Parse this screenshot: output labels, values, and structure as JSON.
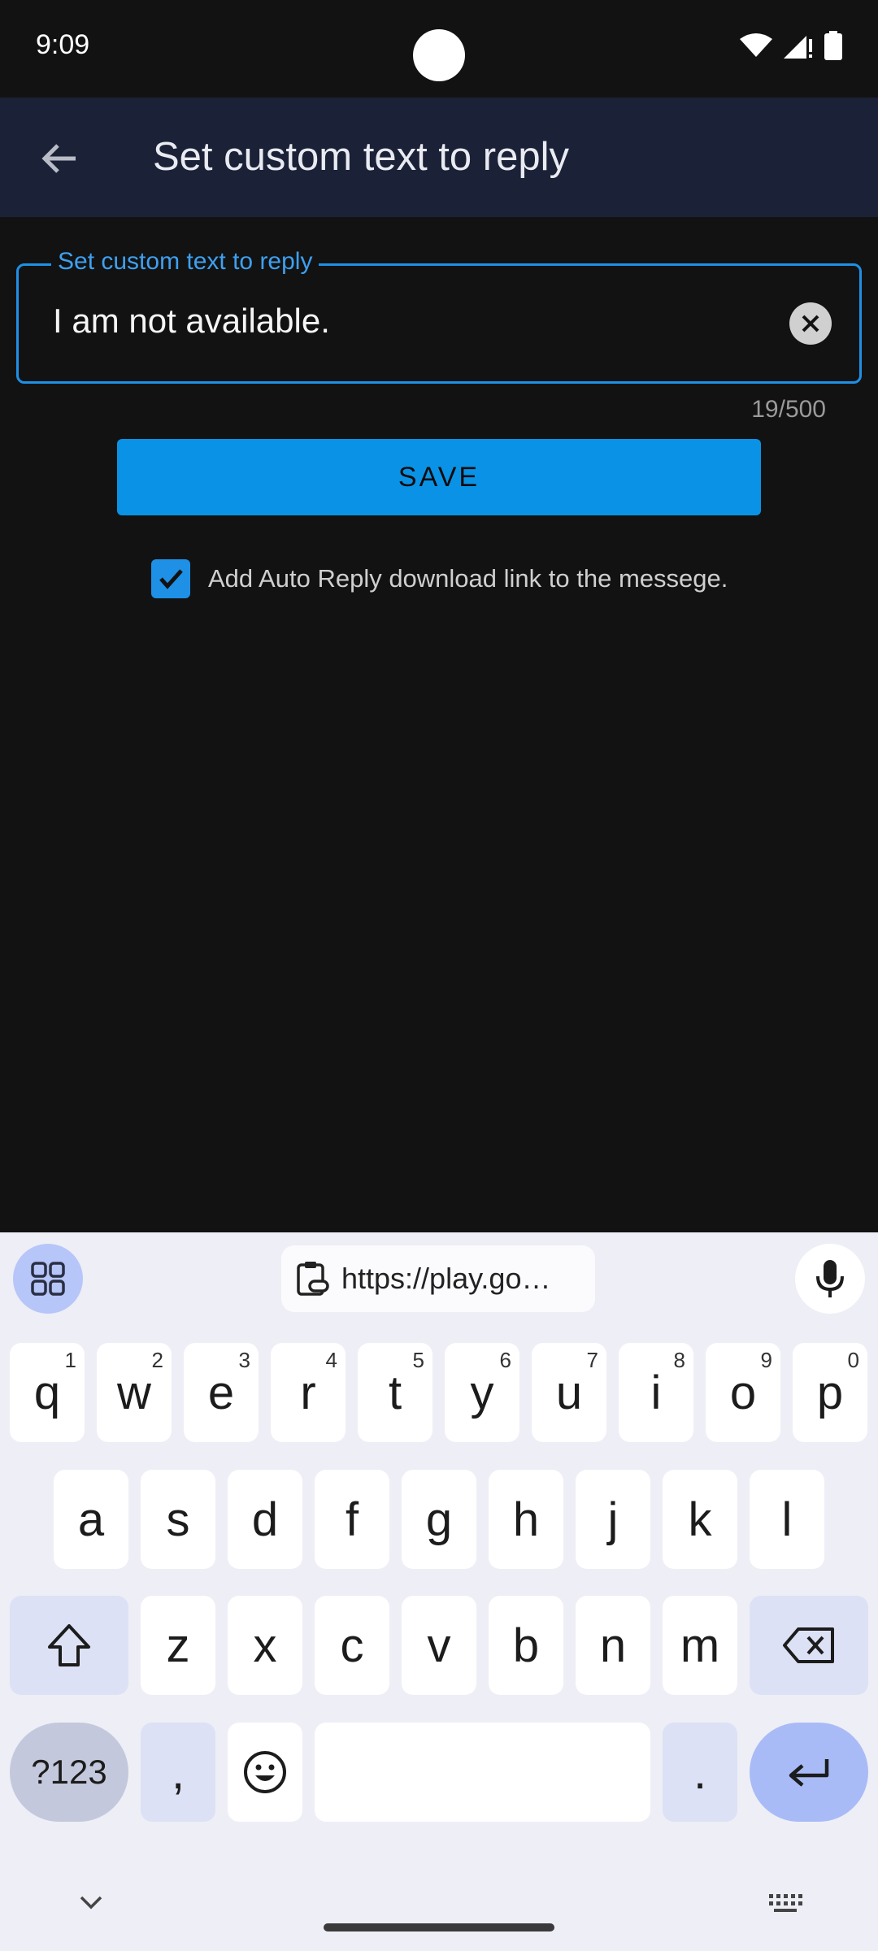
{
  "status_bar": {
    "time": "9:09"
  },
  "app_bar": {
    "title": "Set custom text to reply"
  },
  "reply_field": {
    "label": "Set custom text to reply",
    "value": "I am not available.",
    "counter": "19/500"
  },
  "save_button": {
    "label": "SAVE"
  },
  "download_link_option": {
    "checked": true,
    "label": "Add Auto Reply download link to the messege."
  },
  "keyboard": {
    "clipboard_suggestion": "https://play.go…",
    "row1": [
      {
        "key": "q",
        "hint": "1"
      },
      {
        "key": "w",
        "hint": "2"
      },
      {
        "key": "e",
        "hint": "3"
      },
      {
        "key": "r",
        "hint": "4"
      },
      {
        "key": "t",
        "hint": "5"
      },
      {
        "key": "y",
        "hint": "6"
      },
      {
        "key": "u",
        "hint": "7"
      },
      {
        "key": "i",
        "hint": "8"
      },
      {
        "key": "o",
        "hint": "9"
      },
      {
        "key": "p",
        "hint": "0"
      }
    ],
    "row2": [
      "a",
      "s",
      "d",
      "f",
      "g",
      "h",
      "j",
      "k",
      "l"
    ],
    "row3": [
      "z",
      "x",
      "c",
      "v",
      "b",
      "n",
      "m"
    ],
    "symbols_key": "?123",
    "comma_key": ",",
    "period_key": "."
  },
  "colors": {
    "background": "#121212",
    "app_bar": "#1b2137",
    "accent": "#1e90e6",
    "save_button": "#0a93e6"
  }
}
